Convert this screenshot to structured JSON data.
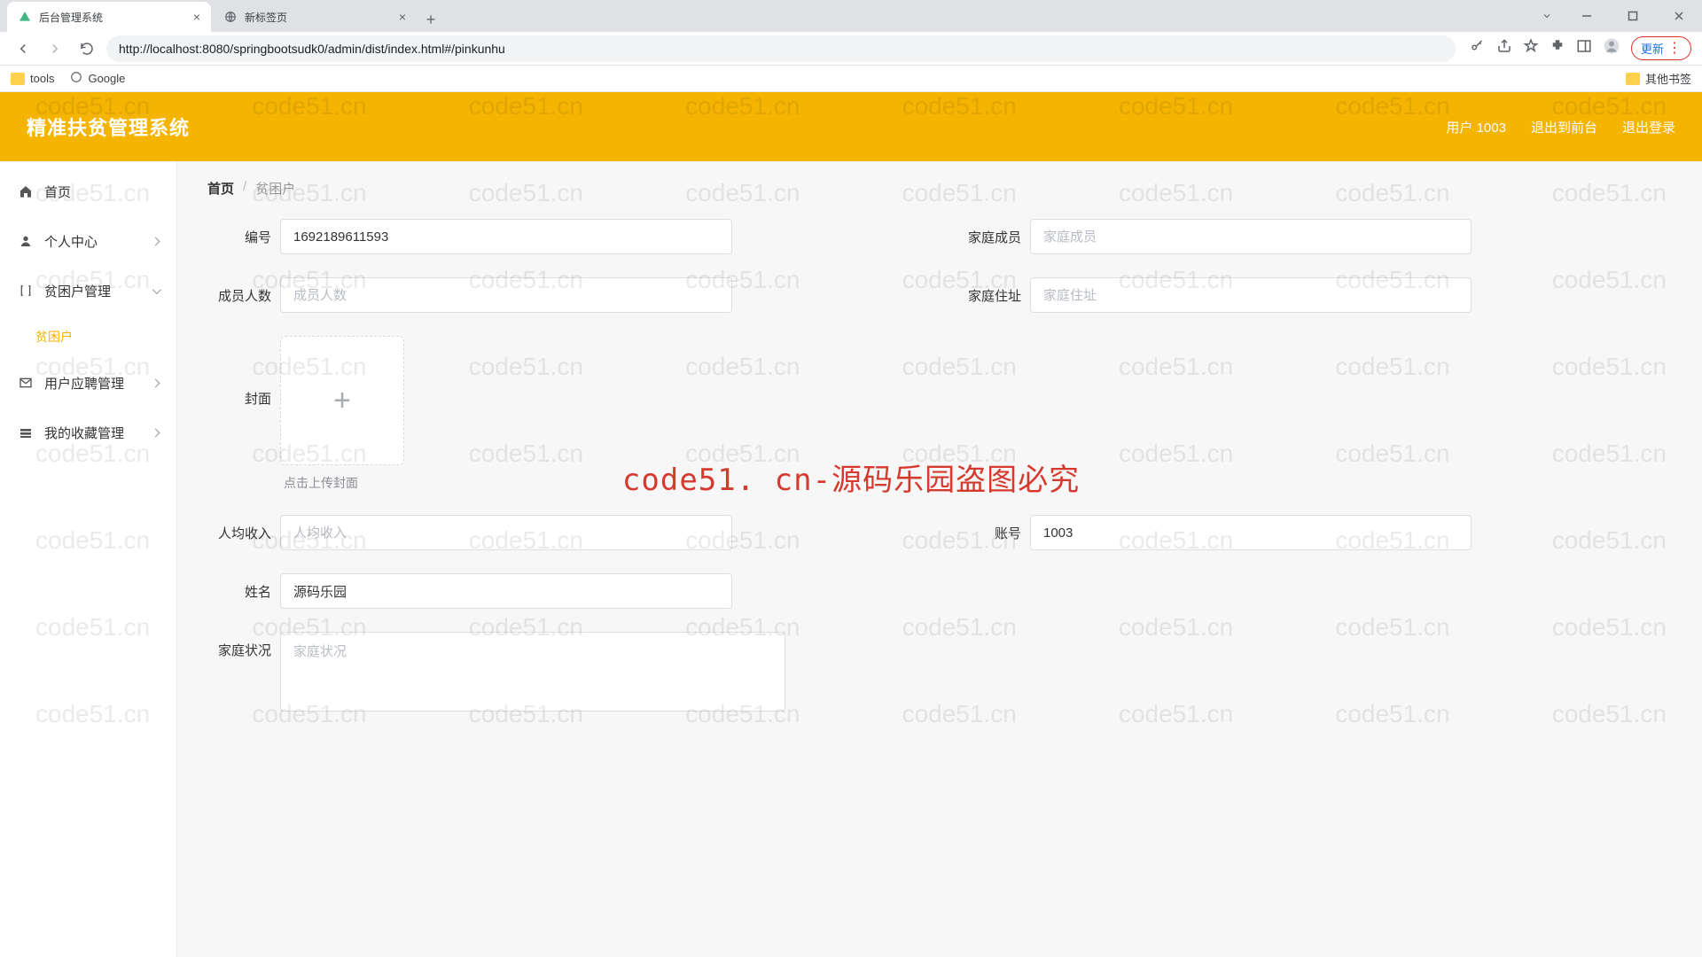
{
  "browser": {
    "tabs": [
      {
        "title": "后台管理系统",
        "active": true
      },
      {
        "title": "新标签页",
        "active": false
      }
    ],
    "url": "http://localhost:8080/springbootsudk0/admin/dist/index.html#/pinkunhu",
    "bookmarks": {
      "tools": "tools",
      "google": "Google",
      "other": "其他书签"
    },
    "update_label": "更新"
  },
  "header": {
    "title": "精准扶贫管理系统",
    "user_label": "用户 1003",
    "return_front": "退出到前台",
    "logout": "退出登录"
  },
  "sidebar": {
    "items": [
      {
        "label": "首页",
        "icon": "home"
      },
      {
        "label": "个人中心",
        "icon": "user",
        "expandable": true
      },
      {
        "label": "贫困户管理",
        "icon": "bracket",
        "expandable": true,
        "expanded": true
      },
      {
        "label": "贫困户",
        "sub": true,
        "active": true
      },
      {
        "label": "用户应聘管理",
        "icon": "mail",
        "expandable": true
      },
      {
        "label": "我的收藏管理",
        "icon": "folder",
        "expandable": true
      }
    ]
  },
  "breadcrumb": {
    "home": "首页",
    "current": "贫困户"
  },
  "form": {
    "id_label": "编号",
    "id_value": "1692189611593",
    "family_members_label": "家庭成员",
    "family_members_placeholder": "家庭成员",
    "member_count_label": "成员人数",
    "member_count_placeholder": "成员人数",
    "family_address_label": "家庭住址",
    "family_address_placeholder": "家庭住址",
    "cover_label": "封面",
    "upload_hint": "点击上传封面",
    "income_label": "人均收入",
    "income_placeholder": "人均收入",
    "account_label": "账号",
    "account_value": "1003",
    "name_label": "姓名",
    "name_value": "源码乐园",
    "status_label": "家庭状况",
    "status_placeholder": "家庭状况"
  },
  "watermark": {
    "tile": "code51.cn",
    "banner": "code51. cn-源码乐园盗图必究"
  }
}
